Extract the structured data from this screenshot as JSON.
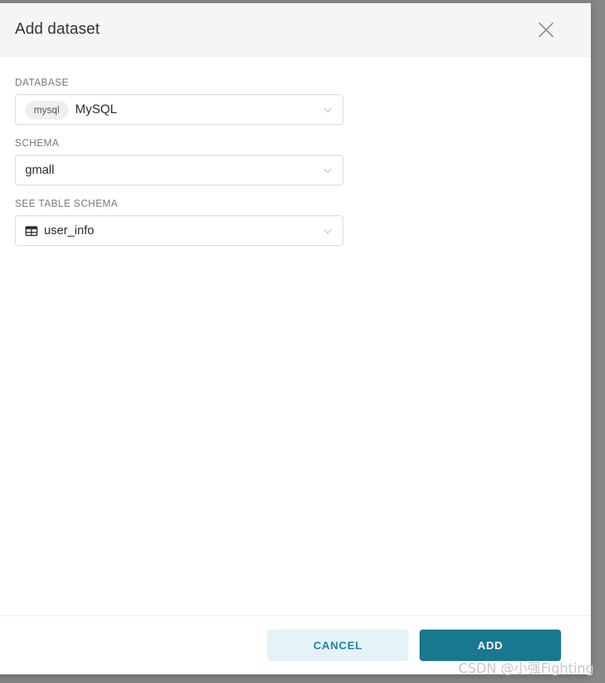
{
  "modal": {
    "title": "Add dataset",
    "close_icon": "close-icon"
  },
  "fields": {
    "database": {
      "label": "DATABASE",
      "tag": "mysql",
      "value": "MySQL",
      "chevron_icon": "chevron-down-icon"
    },
    "schema": {
      "label": "SCHEMA",
      "value": "gmall",
      "chevron_icon": "chevron-down-icon"
    },
    "table": {
      "label": "SEE TABLE SCHEMA",
      "icon": "table-icon",
      "value": "user_info",
      "chevron_icon": "chevron-down-icon"
    }
  },
  "footer": {
    "cancel_label": "CANCEL",
    "add_label": "ADD"
  },
  "watermark": {
    "text": "CSDN @小强Fighting"
  },
  "colors": {
    "accent": "#17788f",
    "accent_soft": "#e4f3f7",
    "header_bg": "#f5f5f5",
    "backdrop": "#878787",
    "border": "#d9d9d9"
  }
}
